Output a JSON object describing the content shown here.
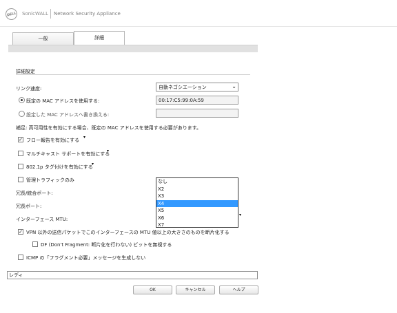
{
  "header": {
    "logo_text": "DELL",
    "brand": "SonicWALL",
    "product": "Network Security Appliance"
  },
  "tabs": [
    {
      "label": "一般",
      "active": false
    },
    {
      "label": "詳細",
      "active": true
    }
  ],
  "section": {
    "title": "詳細設定"
  },
  "form": {
    "link_speed_label": "リンク速度:",
    "link_speed_value": "自動ネゴシエーション",
    "default_mac_label": "既定の MAC アドレスを使用する:",
    "default_mac_value": "00:17:C5:99:0A:59",
    "override_mac_label": "設定した MAC アドレスへ書き換える:",
    "override_mac_value": "",
    "note": "補足: 高可用性を有効にする場合、既定の MAC アドレスを使用する必要があります。",
    "flow_report_label": "フロー報告を有効にする",
    "multicast_label": "マルチキャスト サポートを有効にする",
    "dot1p_label": "802.1p タグ付けを有効にする",
    "mgmt_traffic_label": "管理トラフィックのみ",
    "redundant_agg_label": "冗長/統合ポート:",
    "redundant_port_label": "冗長ポート:",
    "mtu_label": "インターフェース MTU:",
    "vpn_fragment_label": "VPN 以外の送信パケットでこのインターフェースの MTU 値以上の大きさのものを断片化する",
    "df_label": "DF (Don't Fragment: 断片化を行わない) ビットを無視する",
    "icmp_label": "ICMP の「フラグメント必要」メッセージを生成しない"
  },
  "dropdown": {
    "options": [
      "なし",
      "X2",
      "X3",
      "X4",
      "X5",
      "X6",
      "X7"
    ],
    "selected": "X4"
  },
  "status": {
    "text": "レディ"
  },
  "buttons": {
    "ok": "OK",
    "cancel": "キャンセル",
    "help": "ヘルプ"
  }
}
